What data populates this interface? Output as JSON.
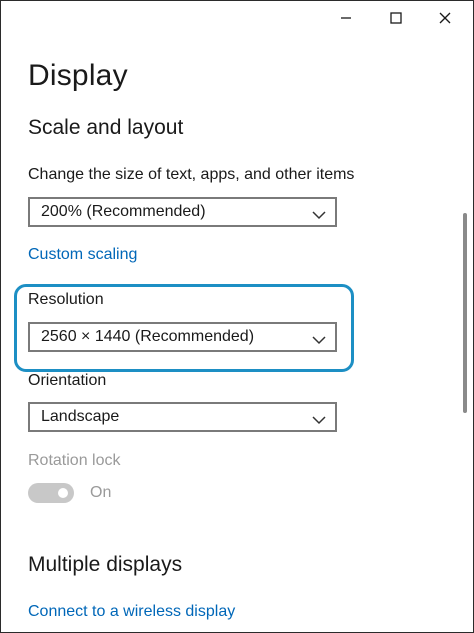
{
  "window": {
    "minimize_icon": "minimize-icon",
    "maximize_icon": "maximize-icon",
    "close_icon": "close-icon"
  },
  "page": {
    "title": "Display",
    "section_scale": "Scale and layout",
    "scale_label": "Change the size of text, apps, and other items",
    "scale_value": "200% (Recommended)",
    "custom_scaling_link": "Custom scaling",
    "resolution_label": "Resolution",
    "resolution_value": "2560 × 1440 (Recommended)",
    "orientation_label": "Orientation",
    "orientation_value": "Landscape",
    "rotation_lock_label": "Rotation lock",
    "rotation_lock_state": "On",
    "section_multiple": "Multiple displays",
    "wireless_link": "Connect to a wireless display"
  },
  "colors": {
    "accent_link": "#0067b8",
    "highlight_border": "#1d8fc4",
    "disabled_text": "#9a9a9a"
  }
}
